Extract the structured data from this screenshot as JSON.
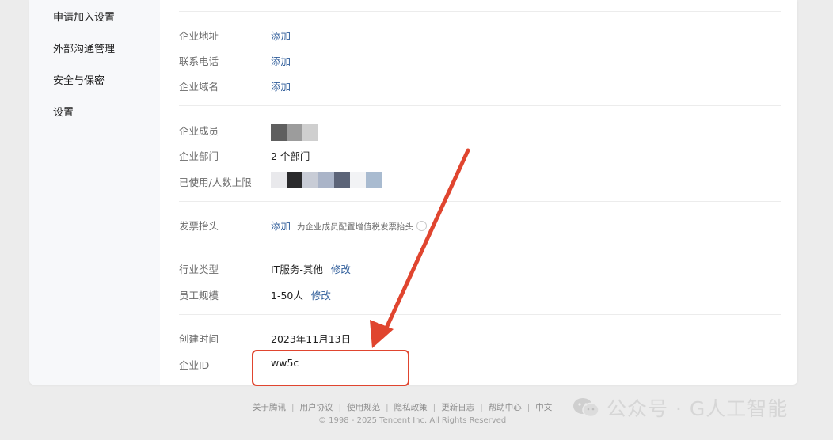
{
  "sidebar": {
    "items": [
      {
        "label": "申请加入设置"
      },
      {
        "label": "外部沟通管理"
      },
      {
        "label": "安全与保密"
      },
      {
        "label": "设置"
      }
    ]
  },
  "info": {
    "address": {
      "label": "企业地址",
      "action": "添加"
    },
    "phone": {
      "label": "联系电话",
      "action": "添加"
    },
    "domain": {
      "label": "企业域名",
      "action": "添加"
    },
    "members": {
      "label": "企业成员"
    },
    "departments": {
      "label": "企业部门",
      "value": "2 个部门"
    },
    "seats": {
      "label": "已使用/人数上限"
    },
    "invoice": {
      "label": "发票抬头",
      "action": "添加",
      "hint": "为企业成员配置增值税发票抬头"
    },
    "industry": {
      "label": "行业类型",
      "value": "IT服务-其他",
      "action": "修改"
    },
    "size": {
      "label": "员工规模",
      "value": "1-50人",
      "action": "修改"
    },
    "created": {
      "label": "创建时间",
      "value": "2023年11月13日"
    },
    "corp_id": {
      "label": "企业ID",
      "value": "ww5c"
    }
  },
  "footer": {
    "links": [
      "关于腾讯",
      "用户协议",
      "使用规范",
      "隐私政策",
      "更新日志",
      "帮助中心",
      "中文"
    ],
    "copyright": "© 1998 - 2025 Tencent Inc. All Rights Reserved"
  },
  "watermark": {
    "text": "公众号 · G人工智能",
    "icon": "wechat-icon"
  },
  "colors": {
    "link": "#2f5d9a",
    "annotation": "#e0452f",
    "sidebar_bg": "#f7f8fa"
  }
}
